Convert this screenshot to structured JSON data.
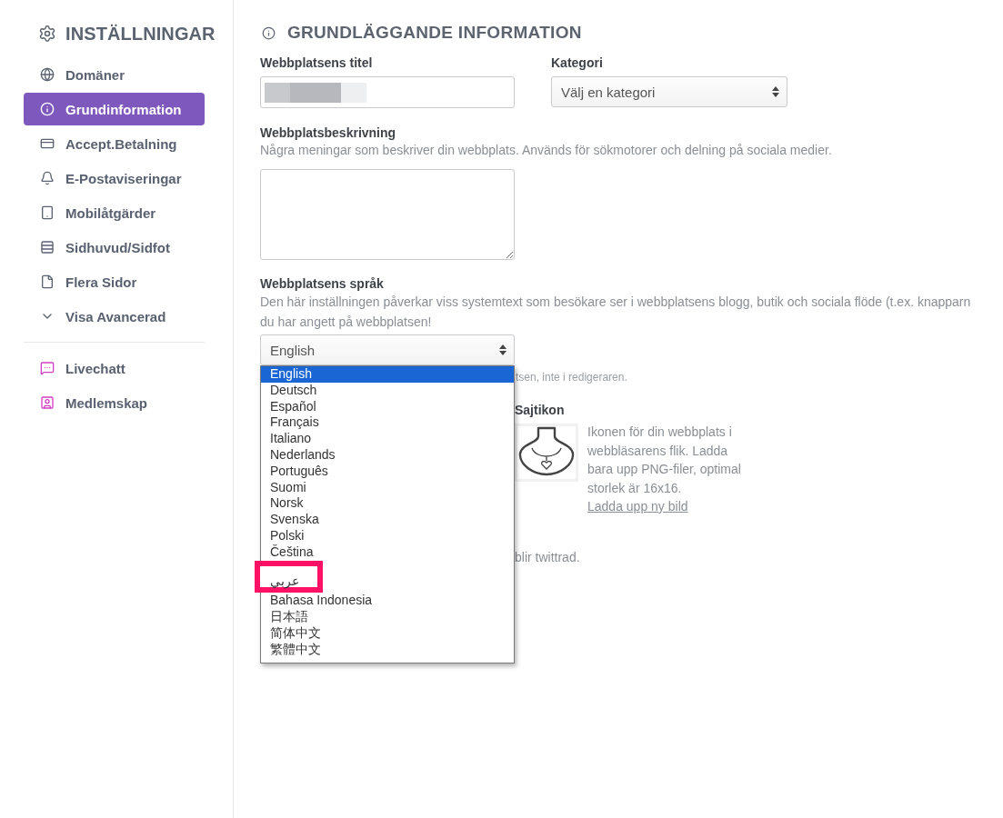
{
  "sidebar": {
    "title": "INSTÄLLNINGAR",
    "items": [
      {
        "label": "Domäner",
        "selected": false
      },
      {
        "label": "Grundinformation",
        "selected": true
      },
      {
        "label": "Accept.Betalning",
        "selected": false
      },
      {
        "label": "E-Postaviseringar",
        "selected": false
      },
      {
        "label": "Mobilåtgärder",
        "selected": false
      },
      {
        "label": "Sidhuvud/Sidfot",
        "selected": false
      },
      {
        "label": "Flera Sidor",
        "selected": false
      }
    ],
    "advanced": {
      "label": "Visa Avancerad",
      "expanded": false
    },
    "apps": [
      {
        "label": "Livechatt",
        "selected": false
      },
      {
        "label": "Medlemskap",
        "selected": false
      }
    ]
  },
  "section": {
    "title": "GRUNDLÄGGANDE INFORMATION"
  },
  "title_field": {
    "label": "Webbplatsens titel",
    "redacted": true
  },
  "category_field": {
    "label": "Kategori",
    "value": "Välj en kategori"
  },
  "description_field": {
    "label": "Webbplatsbeskrivning",
    "hint": "Några meningar som beskriver din webbplats. Används för sökmotorer och delning på sociala medier."
  },
  "language_field": {
    "label": "Webbplatsens språk",
    "hint_lines": [
      "Den här inställningen påverkar viss systemtext som besökare ser i webbplatsens blogg, butik och sociala flöde (t.ex. knapparn",
      "du har angett på webbplatsen!"
    ],
    "value": "English",
    "open": true,
    "options": [
      {
        "label": "English",
        "selected": true,
        "highlighted": false
      },
      {
        "label": "Deutsch",
        "selected": false,
        "highlighted": false
      },
      {
        "label": "Español",
        "selected": false,
        "highlighted": false
      },
      {
        "label": "Français",
        "selected": false,
        "highlighted": false
      },
      {
        "label": "Italiano",
        "selected": false,
        "highlighted": false
      },
      {
        "label": "Nederlands",
        "selected": false,
        "highlighted": false
      },
      {
        "label": "Português",
        "selected": false,
        "highlighted": false
      },
      {
        "label": "Suomi",
        "selected": false,
        "highlighted": false
      },
      {
        "label": "Norsk",
        "selected": false,
        "highlighted": false
      },
      {
        "label": "Svenska",
        "selected": false,
        "highlighted": false
      },
      {
        "label": "Polski",
        "selected": false,
        "highlighted": false
      },
      {
        "label": "Čeština",
        "selected": false,
        "highlighted": false
      },
      {
        "label": "عربي",
        "selected": false,
        "highlighted": true
      },
      {
        "label": "Bahasa Indonesia",
        "selected": false,
        "highlighted": false
      },
      {
        "label": "日本語",
        "selected": false,
        "highlighted": false
      },
      {
        "label": "简体中文",
        "selected": false,
        "highlighted": false
      },
      {
        "label": "繁體中文",
        "selected": false,
        "highlighted": false
      }
    ]
  },
  "language_note": "tsen, inte i redigeraren.",
  "site_icon": {
    "label": "Sajtikon",
    "description": "Ikonen för din webbplats i webbläsarens flik. Ladda bara upp PNG-filer, optimal storlek är 16x16.",
    "link": "Ladda upp ny bild"
  },
  "share_note": "blir twittrad."
}
